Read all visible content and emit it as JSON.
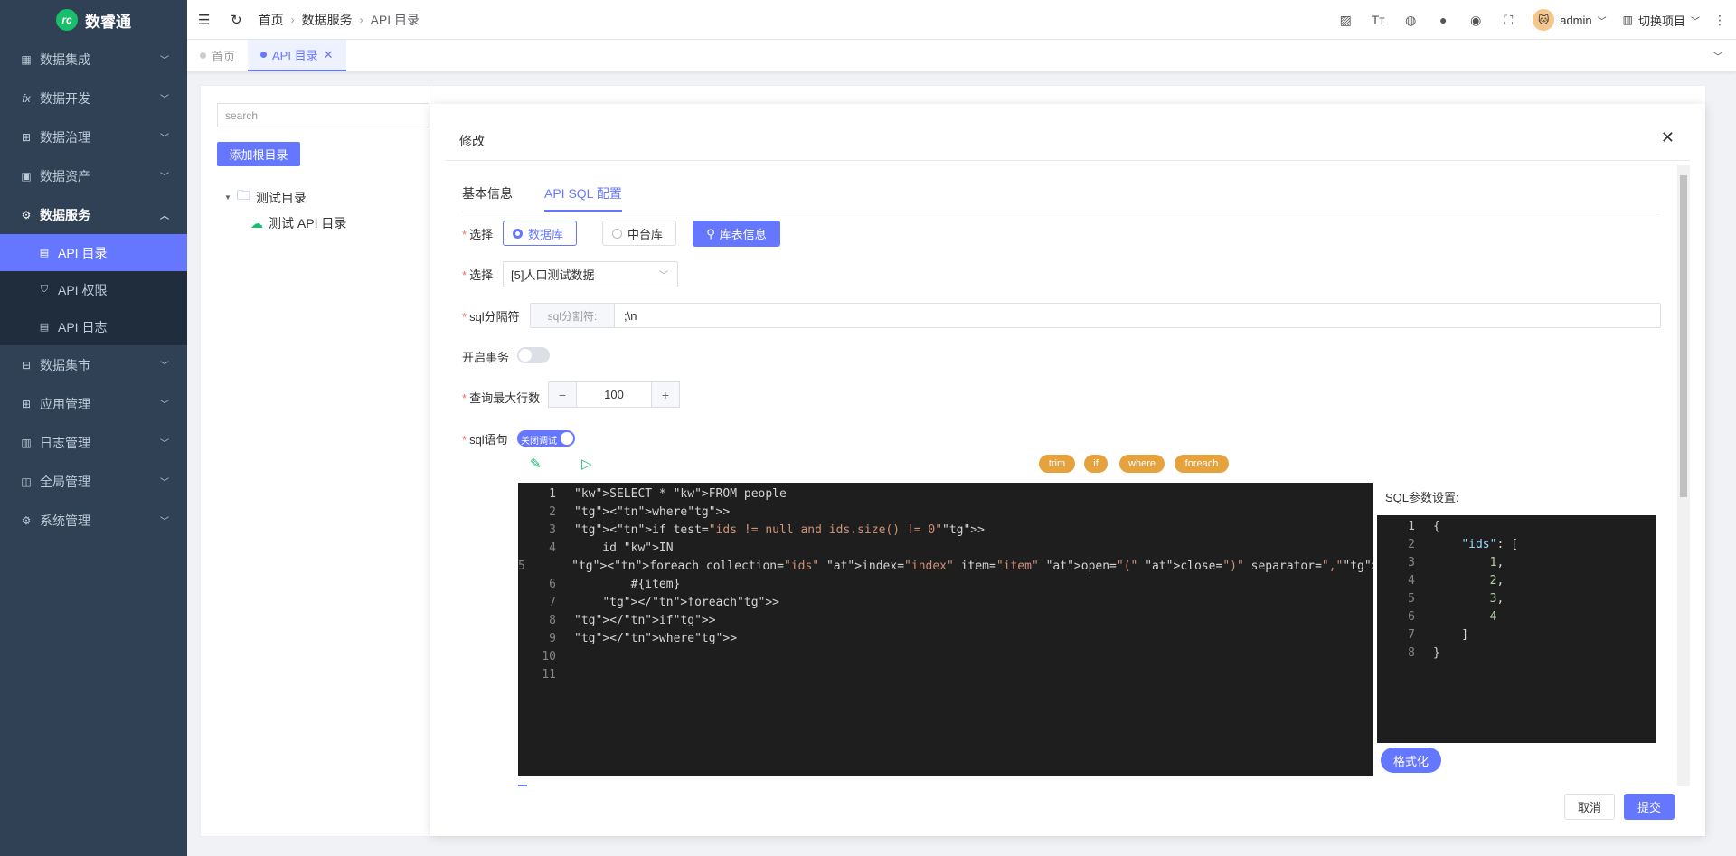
{
  "app": {
    "title": "数睿通"
  },
  "sidebar": {
    "items": [
      {
        "label": "数据集成",
        "icon": "grid-icon"
      },
      {
        "label": "数据开发",
        "icon": "fx-icon"
      },
      {
        "label": "数据治理",
        "icon": "table-icon"
      },
      {
        "label": "数据资产",
        "icon": "asset-icon"
      },
      {
        "label": "数据服务",
        "icon": "gear-icon"
      },
      {
        "label": "数据集市",
        "icon": "market-icon"
      },
      {
        "label": "应用管理",
        "icon": "apps-icon"
      },
      {
        "label": "日志管理",
        "icon": "log-icon"
      },
      {
        "label": "全局管理",
        "icon": "global-icon"
      },
      {
        "label": "系统管理",
        "icon": "system-icon"
      }
    ],
    "sub_items": [
      {
        "label": "API 目录"
      },
      {
        "label": "API 权限"
      },
      {
        "label": "API 日志"
      }
    ]
  },
  "header": {
    "breadcrumb": [
      "首页",
      "数据服务",
      "API 目录"
    ],
    "user": "admin",
    "project": "切换项目"
  },
  "tags": [
    {
      "label": "首页"
    },
    {
      "label": "API 目录"
    }
  ],
  "tree": {
    "search_placeholder": "search",
    "add_root": "添加根目录",
    "folder": "测试目录",
    "child": "测试 API 目录"
  },
  "dialog": {
    "title": "修改",
    "tabs": [
      "基本信息",
      "API SQL 配置"
    ],
    "select_label": "选择",
    "radio_db": "数据库",
    "radio_middle": "中台库",
    "table_info": "库表信息",
    "select2_label": "选择",
    "db_value": "[5]人口测试数据",
    "sql_sep_label": "sql分隔符",
    "sql_sep_addon": "sql分割符:",
    "sql_sep_value": ";\\n",
    "tx_label": "开启事务",
    "max_rows_label": "查询最大行数",
    "max_rows": "100",
    "sql_label": "sql语句",
    "debug_switch": "关闭调试",
    "chips": [
      "trim",
      "if",
      "where",
      "foreach"
    ],
    "param_label": "SQL参数设置:",
    "format_btn": "格式化",
    "cancel": "取消",
    "submit": "提交"
  },
  "sql_lines": [
    "SELECT * FROM people",
    "<where>",
    "<if test=\"ids != null and ids.size() != 0\">",
    "    id IN",
    "    <foreach collection=\"ids\" index=\"index\" item=\"item\" open=\"(\" close=\")\" separator=\",\">",
    "        #{item}",
    "    </foreach>",
    "</if>",
    "</where>",
    "",
    ""
  ],
  "json_lines": [
    "{",
    "    \"ids\": [",
    "        1,",
    "        2,",
    "        3,",
    "        4",
    "    ]",
    "}"
  ]
}
